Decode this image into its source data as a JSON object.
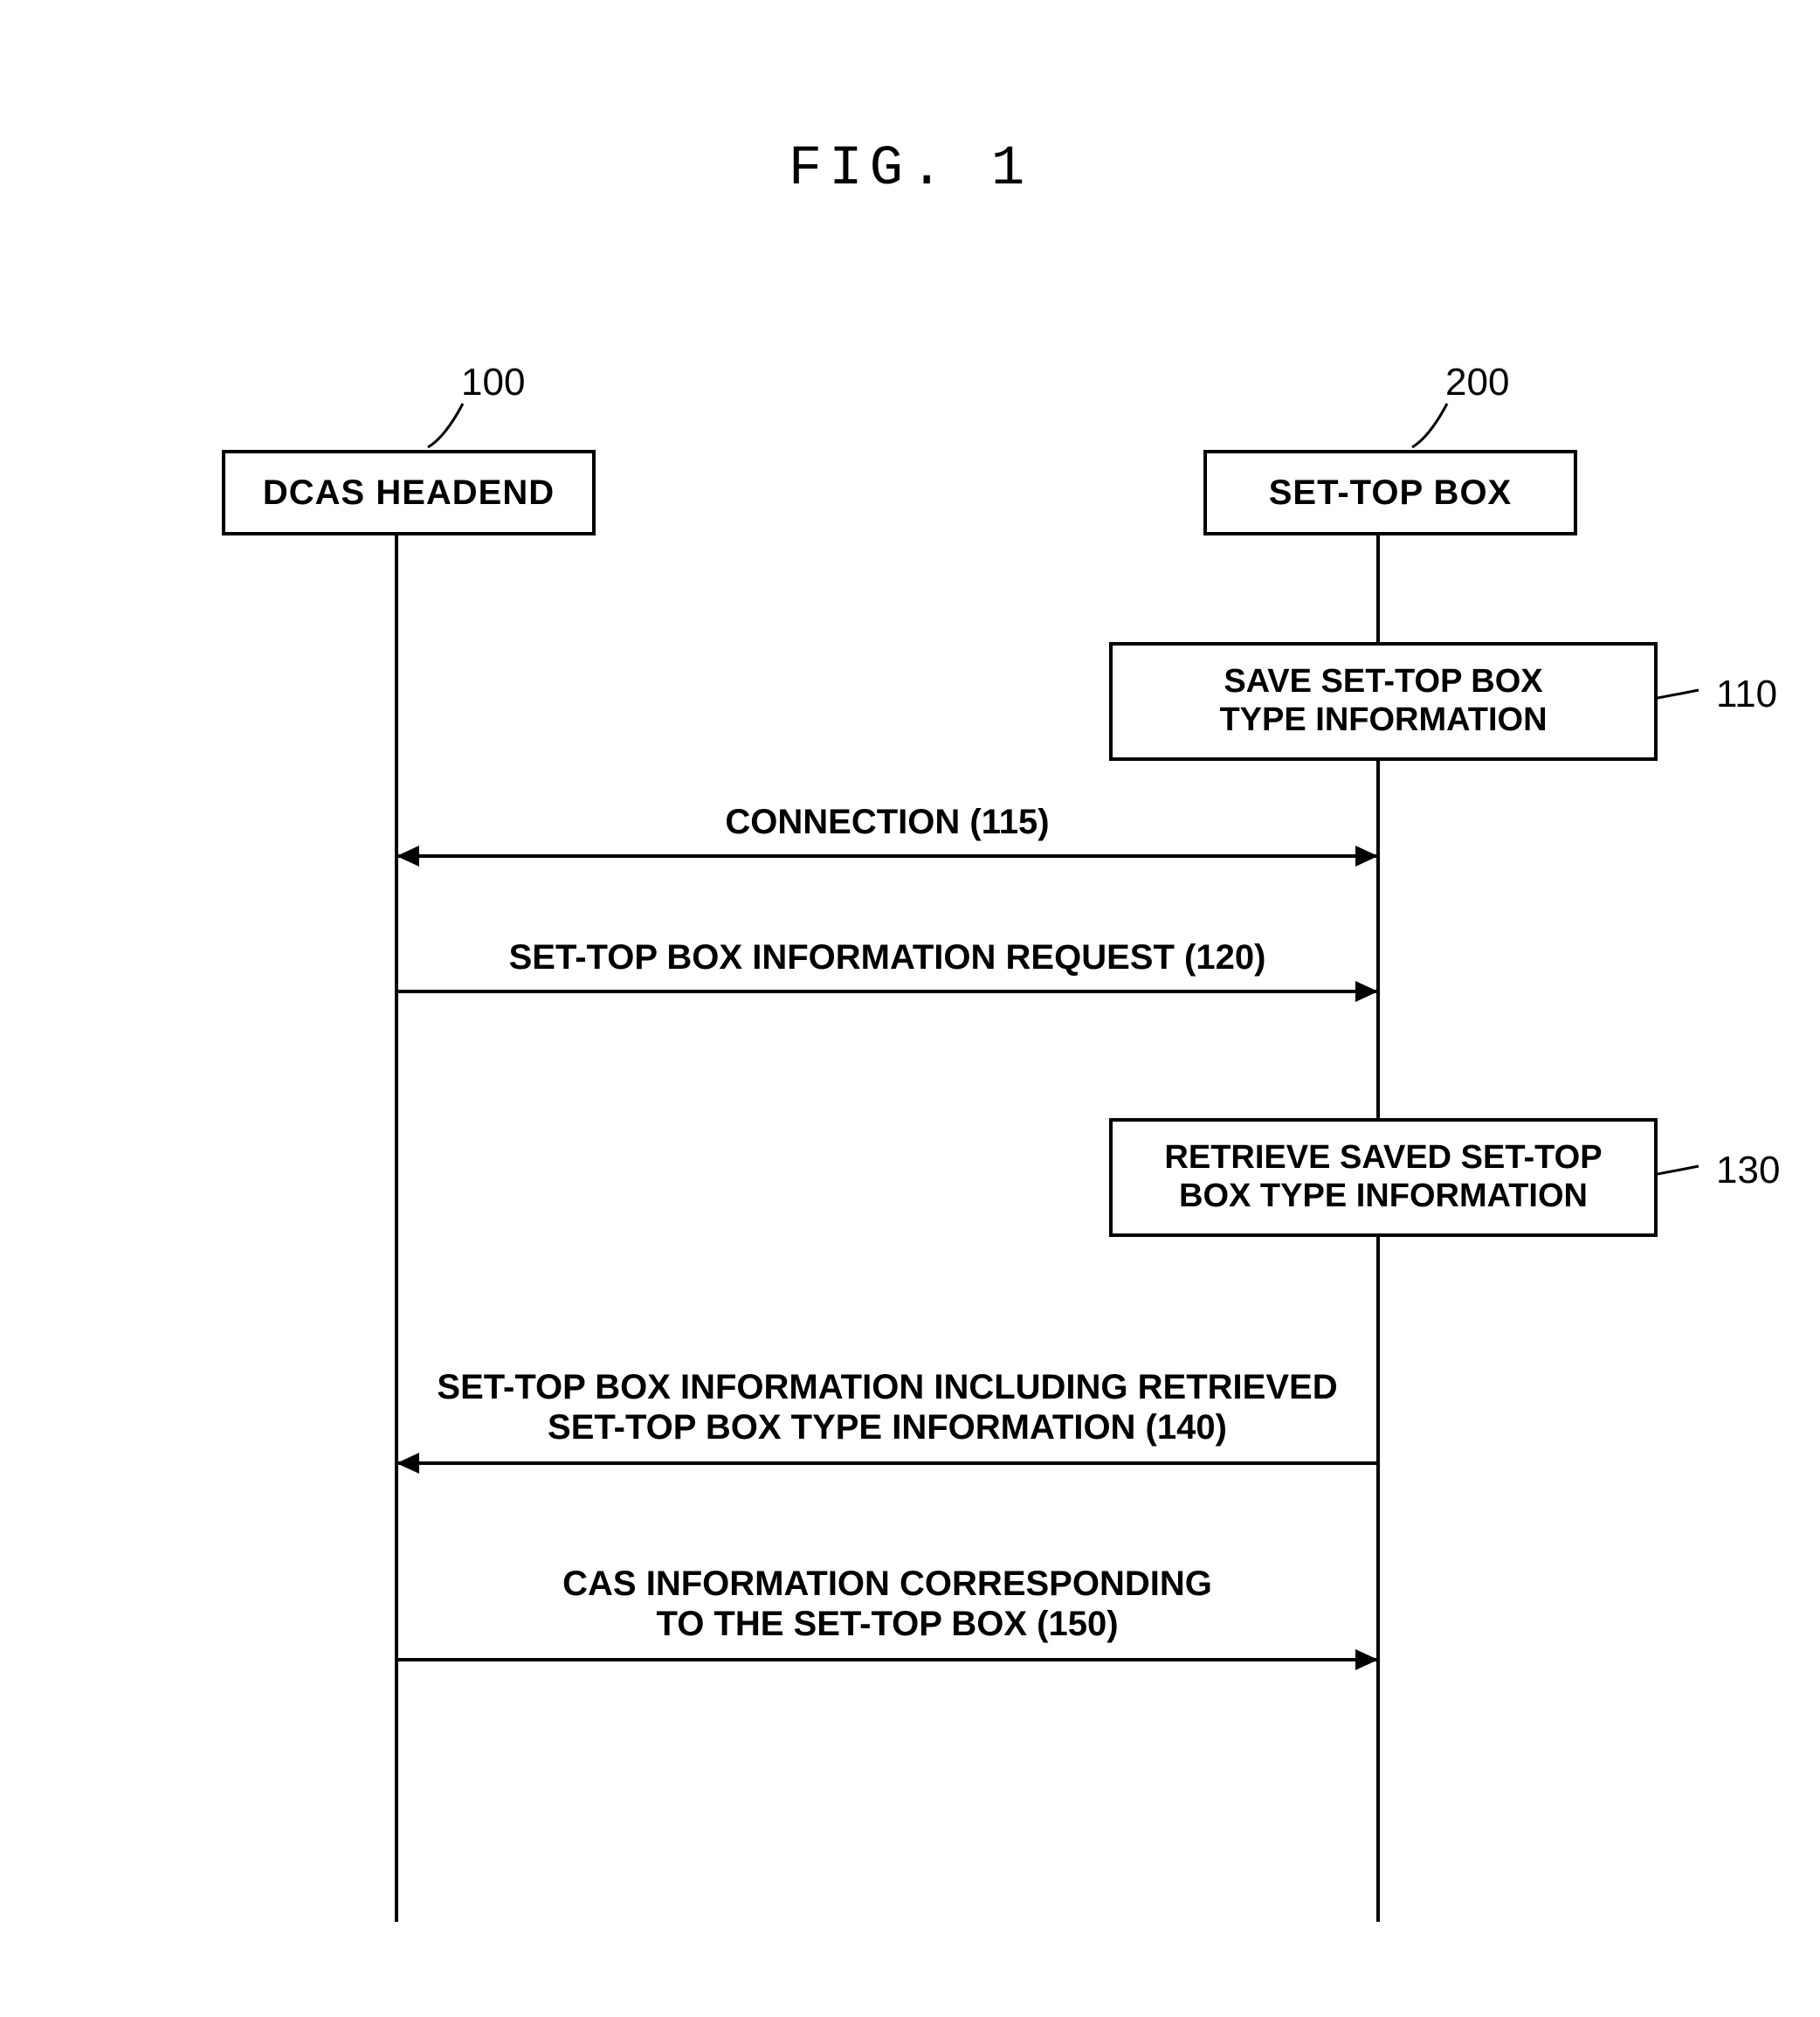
{
  "figure_title": "FIG. 1",
  "actors": {
    "left": {
      "label": "DCAS HEADEND",
      "ref": "100"
    },
    "right": {
      "label": "SET-TOP BOX",
      "ref": "200"
    }
  },
  "steps": {
    "s110": {
      "text": "SAVE SET-TOP BOX\nTYPE INFORMATION",
      "ref": "110"
    },
    "s130": {
      "text": "RETRIEVE SAVED SET-TOP\nBOX TYPE INFORMATION",
      "ref": "130"
    }
  },
  "messages": {
    "m115": "CONNECTION (115)",
    "m120": "SET-TOP BOX INFORMATION REQUEST (120)",
    "m140": "SET-TOP BOX INFORMATION INCLUDING RETRIEVED\nSET-TOP BOX TYPE INFORMATION (140)",
    "m150": "CAS INFORMATION CORRESPONDING\nTO THE SET-TOP BOX (150)"
  }
}
